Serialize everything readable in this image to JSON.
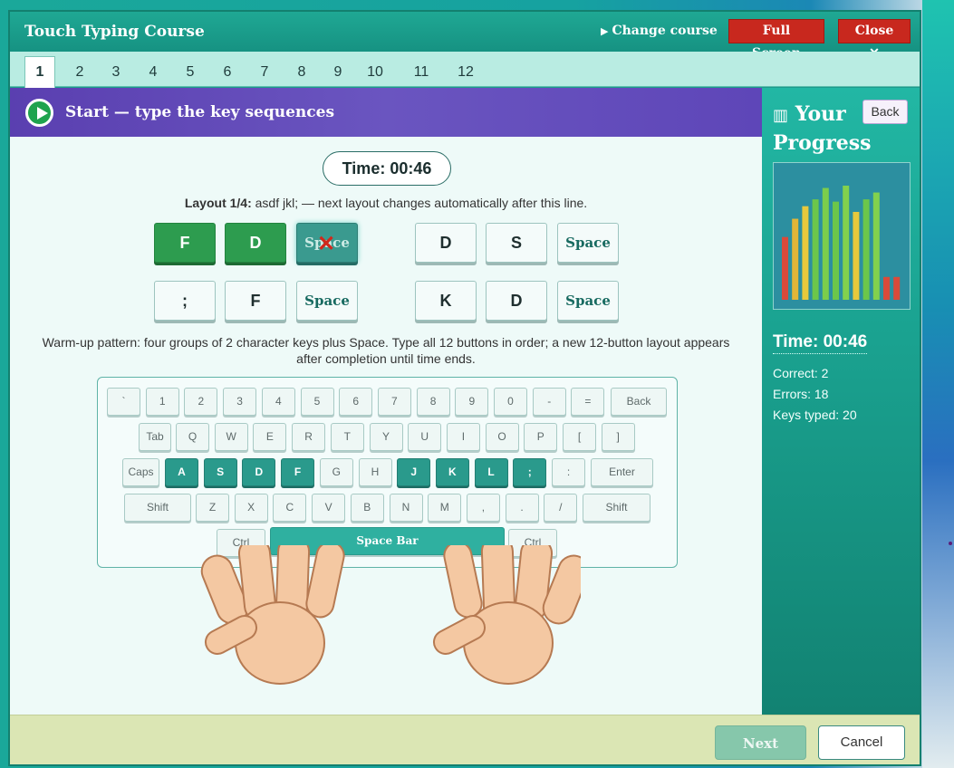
{
  "window": {
    "title": "Touch Typing Course",
    "change_course": "Change course",
    "full_screen": "Full Screen",
    "close": "Close",
    "close_glyph": "✕"
  },
  "tabs": [
    "1",
    "2",
    "3",
    "4",
    "5",
    "6",
    "7",
    "8",
    "9",
    "10",
    "11",
    "12"
  ],
  "active_tab": "1",
  "banner": {
    "title": "Start — type the key sequences"
  },
  "timer": "Time: 00:46",
  "layout_info": {
    "label": "Layout 1/4:",
    "text": " asdf jkl;   — next layout changes automatically after this line."
  },
  "sequence_keys": [
    {
      "label": "F",
      "state": "done"
    },
    {
      "label": "D",
      "state": "done"
    },
    {
      "label": "Space",
      "state": "error"
    },
    {
      "label": "D",
      "state": "pending"
    },
    {
      "label": "S",
      "state": "pending"
    },
    {
      "label": "Space",
      "state": "pending"
    },
    {
      "label": ";",
      "state": "pending"
    },
    {
      "label": "F",
      "state": "pending"
    },
    {
      "label": "Space",
      "state": "pending"
    },
    {
      "label": "K",
      "state": "pending"
    },
    {
      "label": "D",
      "state": "pending"
    },
    {
      "label": "Space",
      "state": "pending"
    }
  ],
  "description": "Warm-up pattern: four groups of 2 character keys plus Space. Type all 12 buttons in order; a new 12-button layout appears after completion until time ends.",
  "keyboard": {
    "row1": [
      "`",
      "1",
      "2",
      "3",
      "4",
      "5",
      "6",
      "7",
      "8",
      "9",
      "0",
      "-",
      "=",
      "Back"
    ],
    "row2": [
      "Tab",
      "Q",
      "W",
      "E",
      "R",
      "T",
      "Y",
      "U",
      "I",
      "O",
      "P",
      "[",
      "]"
    ],
    "row3": [
      "Caps",
      "A",
      "S",
      "D",
      "F",
      "G",
      "H",
      "J",
      "K",
      "L",
      ";",
      ":",
      "Enter"
    ],
    "row4": [
      "Shift",
      "Z",
      "X",
      "C",
      "V",
      "B",
      "N",
      "M",
      ",",
      ".",
      "/",
      "Shift"
    ],
    "row5": [
      "Ctrl",
      "Space Bar",
      "Ctrl"
    ],
    "home_keys": [
      "A",
      "S",
      "D",
      "F",
      "J",
      "K",
      "L",
      ";"
    ]
  },
  "sidebar": {
    "title": "Your Progress",
    "back": "Back",
    "timer": "Time: 00:46",
    "correct": "Correct: 2",
    "errors": "Errors: 18",
    "keys_typed": "Keys typed: 20",
    "progress_bars": [
      {
        "value": 0.55,
        "color": "#d94a3a"
      },
      {
        "value": 0.71,
        "color": "#e2b637"
      },
      {
        "value": 0.82,
        "color": "#e7c93c"
      },
      {
        "value": 0.88,
        "color": "#6cc64a"
      },
      {
        "value": 0.98,
        "color": "#7ccd4b"
      },
      {
        "value": 0.86,
        "color": "#6cc64a"
      },
      {
        "value": 1.0,
        "color": "#82d14d"
      },
      {
        "value": 0.77,
        "color": "#e7c93c"
      },
      {
        "value": 0.88,
        "color": "#6cc64a"
      },
      {
        "value": 0.94,
        "color": "#82d14d"
      },
      {
        "value": 0.2,
        "color": "#d94a3a"
      },
      {
        "value": 0.2,
        "color": "#d94a3a"
      }
    ]
  },
  "footer": {
    "next": "Next",
    "cancel": "Cancel"
  }
}
